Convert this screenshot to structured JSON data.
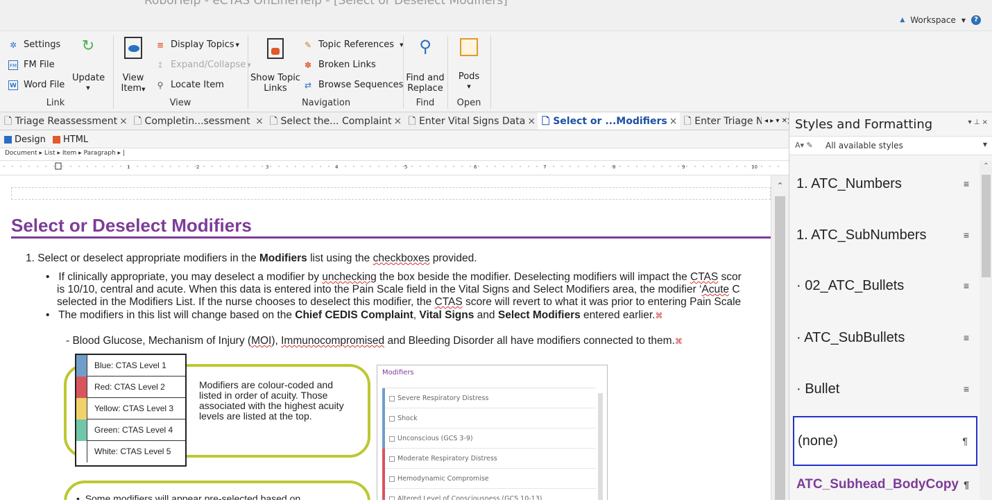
{
  "window": {
    "title": "RoboHelp - eCTAS OnLineHelp - [Select or Deselect Modifiers]",
    "workspace": "Workspace"
  },
  "ribbon": {
    "link": {
      "settings": "Settings",
      "fm_file": "FM File",
      "word_file": "Word File",
      "update": "Update",
      "group": "Link"
    },
    "view": {
      "view_item": "View",
      "view_item2": "Item",
      "display_topics": "Display Topics",
      "expand_collapse": "Expand/Collapse",
      "locate_item": "Locate Item",
      "group": "View"
    },
    "navigation": {
      "show_topic": "Show Topic",
      "show_topic2": "Links",
      "topic_references": "Topic References",
      "broken_links": "Broken Links",
      "browse_sequences": "Browse Sequences",
      "group": "Navigation"
    },
    "find": {
      "find_replace": "Find and",
      "find_replace2": "Replace",
      "group": "Find"
    },
    "open": {
      "pods": "Pods",
      "group": "Open"
    }
  },
  "tabs": [
    {
      "label": "Triage Reassessment",
      "active": false
    },
    {
      "label": "Completin...sessment ",
      "active": false
    },
    {
      "label": "Select the... Complaint",
      "active": false
    },
    {
      "label": "Enter Vital Signs Data",
      "active": false
    },
    {
      "label": "Select or ...Modifiers",
      "active": true
    },
    {
      "label": "Enter Triage Notes",
      "active": false
    },
    {
      "label": "[",
      "active": false
    }
  ],
  "view_tabs": {
    "design": "Design",
    "html": "HTML"
  },
  "breadcrumb": "Document ▸ List ▸ Item ▸ Paragraph ▸  |",
  "ruler_numbers": [
    "1",
    "2",
    "3",
    "4",
    "5",
    "6",
    "7",
    "8",
    "9",
    "10"
  ],
  "document": {
    "heading": "Select or Deselect Modifiers",
    "step1_a": "1.  Select or deselect appropriate modifiers in the ",
    "step1_b": "Modifiers",
    "step1_c": " list using the ",
    "step1_d": "checkboxes",
    "step1_e": " provided.",
    "b1_l1a": "If clinically appropriate, you may deselect a modifier by ",
    "b1_l1b": "unchecking",
    "b1_l1c": " the box beside the modifier. Deselecting modifiers will impact the ",
    "b1_l1d": "CTAS",
    "b1_l1e": " scor",
    "b1_l2a": "is 10/10, central and acute. When this data is entered into the Pain Scale field in the Vital Signs and Select Modifiers area, the modifier ‘",
    "b1_l2b": "Acute",
    "b1_l2c": " C",
    "b1_l3a": "selected in the Modifiers List. If the nurse chooses to deselect this modifier, the ",
    "b1_l3b": "CTAS",
    "b1_l3c": " score will revert to what it was prior to entering Pain Scale",
    "b2a": "The modifiers in this list will change based on the ",
    "b2b": "Chief CEDIS Complaint",
    "b2c": ", ",
    "b2d": "Vital Signs",
    "b2e": " and ",
    "b2f": "Select Modifiers",
    "b2g": " entered earlier.",
    "dash_a": "- Blood Glucose, Mechanism of Injury (",
    "dash_b": "MOI",
    "dash_c": "), ",
    "dash_d": "Immunocompromised",
    "dash_e": " and Bleeding Disorder all have modifiers connected to them.",
    "callout": "Modifiers are colour-coded and listed in order of acuity. Those associated with the highest acuity levels are listed at the top.",
    "callout2": "Some modifiers will appear pre-selected based on"
  },
  "legend": [
    {
      "label": "Blue: CTAS Level 1",
      "color": "#6f9fc9"
    },
    {
      "label": "Red: CTAS Level 2",
      "color": "#d9555e"
    },
    {
      "label": "Yellow: CTAS Level 3",
      "color": "#f1d26a"
    },
    {
      "label": "Green: CTAS Level 4",
      "color": "#6fc7a8"
    },
    {
      "label": "White: CTAS Level 5",
      "color": "#ffffff"
    }
  ],
  "modifiers": {
    "title": "Modifiers",
    "items": [
      {
        "label": "Severe Respiratory Distress",
        "color": "#6f9fc9"
      },
      {
        "label": "Shock",
        "color": "#6f9fc9"
      },
      {
        "label": "Unconscious (GCS 3-9)",
        "color": "#6f9fc9"
      },
      {
        "label": "Moderate Respiratory Distress",
        "color": "#d9555e"
      },
      {
        "label": "Hemodynamic Compromise",
        "color": "#d9555e"
      },
      {
        "label": "Altered Level of Consciousness (GCS 10-13)",
        "color": "#d9555e"
      }
    ]
  },
  "styles_panel": {
    "title": "Styles and Formatting",
    "filter": "All available styles",
    "items": [
      {
        "label": "1. ATC_Numbers",
        "mark": "≡"
      },
      {
        "label": "1. ATC_SubNumbers",
        "mark": "≡"
      },
      {
        "label": "· 02_ATC_Bullets",
        "mark": "≡"
      },
      {
        "label": "· ATC_SubBullets",
        "mark": "≡"
      },
      {
        "label": "· Bullet",
        "mark": "≡"
      },
      {
        "label": "(none)",
        "mark": "¶"
      },
      {
        "label": "ATC_Subhead_BodyCopy",
        "mark": "¶"
      }
    ]
  }
}
